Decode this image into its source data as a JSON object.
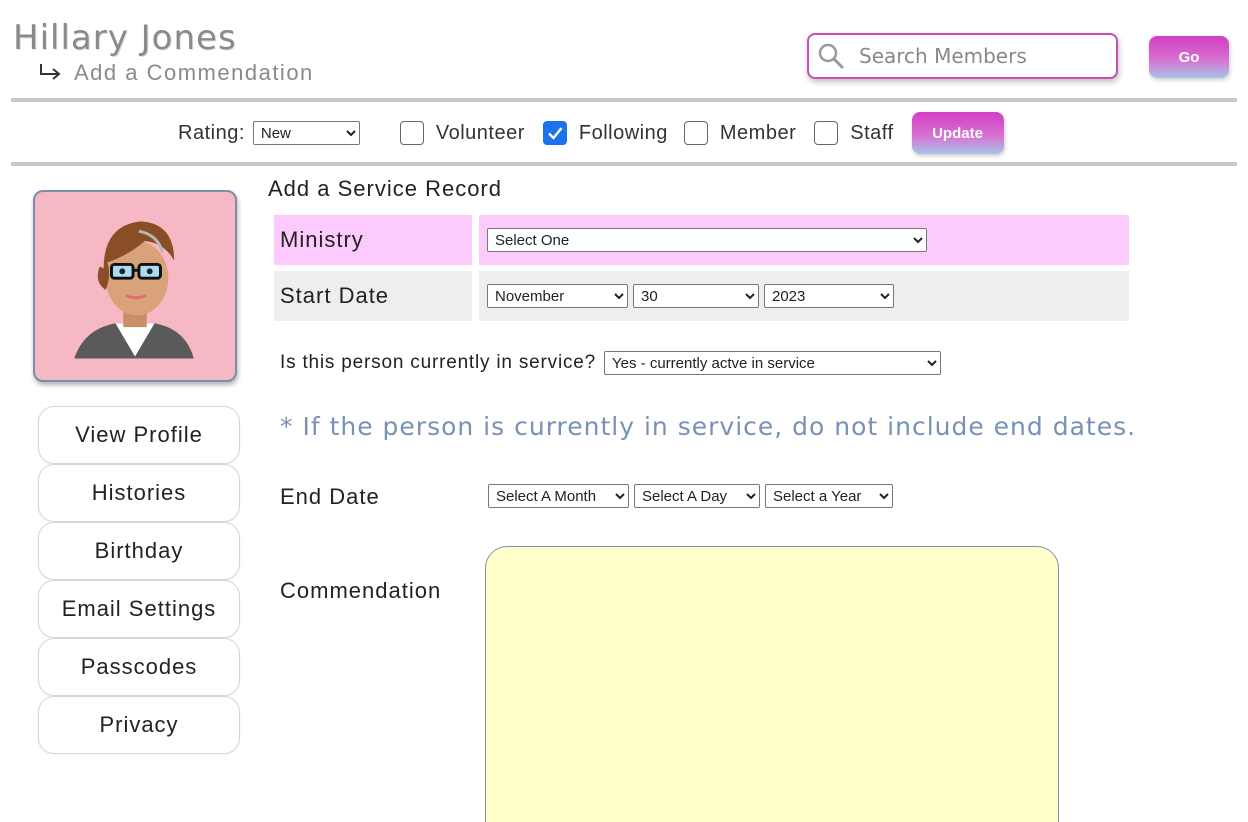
{
  "header": {
    "member_name": "Hillary Jones",
    "subtitle": "Add a Commendation",
    "search_placeholder": "Search Members",
    "go_label": "Go"
  },
  "filters": {
    "rating_label": "Rating:",
    "rating_value": "New",
    "checkboxes": [
      {
        "label": "Volunteer",
        "checked": false
      },
      {
        "label": "Following",
        "checked": true
      },
      {
        "label": "Member",
        "checked": false
      },
      {
        "label": "Staff",
        "checked": false
      }
    ],
    "update_label": "Update"
  },
  "sidebar": {
    "items": [
      {
        "label": "View Profile"
      },
      {
        "label": "Histories"
      },
      {
        "label": "Birthday"
      },
      {
        "label": "Email Settings"
      },
      {
        "label": "Passcodes"
      },
      {
        "label": "Privacy"
      }
    ]
  },
  "form": {
    "title": "Add a Service Record",
    "ministry_label": "Ministry",
    "ministry_value": "Select One",
    "start_label": "Start Date",
    "start_month": "November",
    "start_day": "30",
    "start_year": "2023",
    "in_service_question": "Is this person currently in service?",
    "in_service_value": "Yes - currently actve in service",
    "note": "* If the person is currently in service, do not include end dates.",
    "end_label": "End Date",
    "end_month": "Select A Month",
    "end_day": "Select A Day",
    "end_year": "Select a Year",
    "commendation_label": "Commendation",
    "commendation_value": ""
  },
  "colors": {
    "accent": "#d23fc2",
    "ministry_row": "#fccafc",
    "start_row": "#eeeeee",
    "note_text": "#7891b4",
    "commendation_bg": "#ffffcc",
    "avatar_bg": "#f6b8c4",
    "checkbox_checked": "#1a73e8"
  },
  "icons": {
    "subtitle": "return-arrow-icon",
    "search": "magnifier-icon",
    "checkmark": "checkmark-icon",
    "avatar": "woman-avatar-icon"
  }
}
